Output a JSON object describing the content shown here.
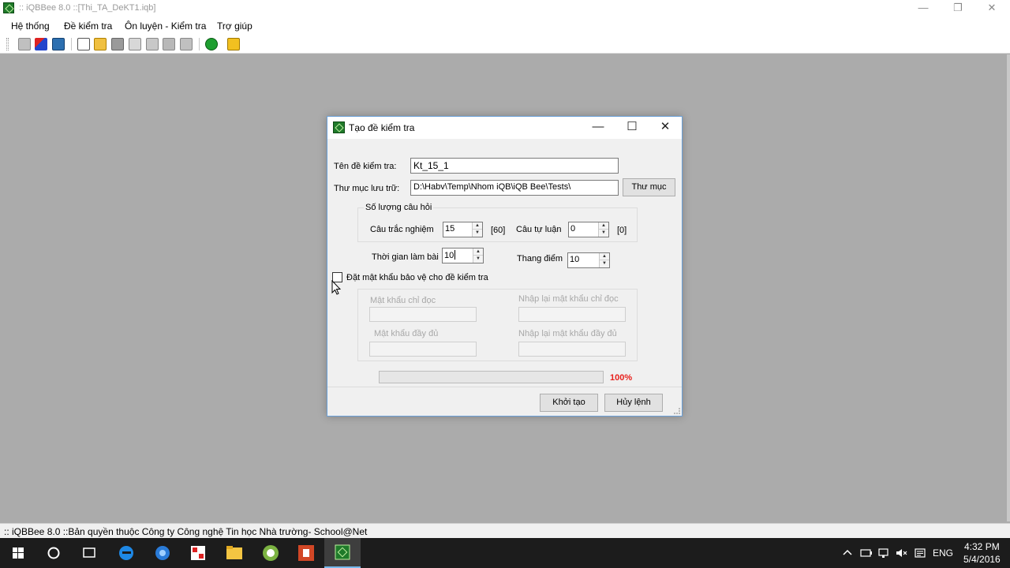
{
  "window": {
    "title": ":: iQBBee 8.0 ::[Thi_TA_DeKT1.iqb]",
    "minimize_glyph": "—",
    "restore_glyph": "❐",
    "close_glyph": "✕"
  },
  "menu": {
    "items": [
      "Hệ thống",
      "Đề kiểm tra",
      "Ôn luyện - Kiểm tra",
      "Trợ giúp"
    ]
  },
  "toolbar": {
    "icons": [
      "toolbar-icon-1",
      "toolbar-icon-2",
      "toolbar-icon-3",
      "new-document-icon",
      "open-folder-icon",
      "save-icon",
      "print-preview-icon",
      "search-icon",
      "tool-icon-8",
      "tool-icon-9",
      "help-icon",
      "exit-icon"
    ]
  },
  "dialog": {
    "title": "Tạo đề kiểm tra",
    "minimize_glyph": "—",
    "maximize_glyph": "☐",
    "close_glyph": "✕",
    "test_name_label": "Tên đề kiểm tra:",
    "test_name_value": "Kt_15_1",
    "folder_label": "Thư mục lưu trữ:",
    "folder_value": "D:\\Habv\\Temp\\Nhom iQB\\iQB Bee\\Tests\\",
    "folder_button": "Thư mục",
    "question_count_group": "Số lượng câu hỏi",
    "multiple_choice_label": "Câu trắc nghiệm",
    "multiple_choice_value": "15",
    "multiple_choice_max": "[60]",
    "essay_label": "Câu tự luận",
    "essay_value": "0",
    "essay_max": "[0]",
    "time_label": "Thời gian làm bài",
    "time_value": "10",
    "score_scale_label": "Thang điểm",
    "score_scale_value": "10",
    "password_checkbox_label": "Đặt mật khẩu bảo vệ cho đề kiểm tra",
    "password_checked": false,
    "readonly_password_label": "Mật khẩu chỉ đọc",
    "readonly_password_confirm_label": "Nhập lại mật khẩu chỉ đọc",
    "full_password_label": "Mật khẩu đầy đủ",
    "full_password_confirm_label": "Nhập lại mật khẩu đầy đủ",
    "progress_percent": 100,
    "progress_label": "100%",
    "create_button": "Khởi tạo",
    "cancel_button": "Hủy lệnh"
  },
  "status": {
    "text": ":: iQBBee 8.0 ::Bản quyền thuộc Công ty Công nghệ Tin học Nhà trường- School@Net"
  },
  "taskbar": {
    "apps": [
      "start-windows-icon",
      "cortana-search-icon",
      "task-view-icon",
      "edge-browser-icon",
      "app-icon-5",
      "app-icon-6",
      "file-explorer-icon",
      "app-icon-8",
      "powerpoint-icon",
      "iqbbee-app-icon"
    ],
    "language": "ENG",
    "time": "4:32 PM",
    "date": "5/4/2016"
  },
  "colors": {
    "workspace": "#ababab",
    "progress_text": "#e8201c",
    "taskbar": "#1c1c1c",
    "dialog_border": "#6aa0d8"
  }
}
